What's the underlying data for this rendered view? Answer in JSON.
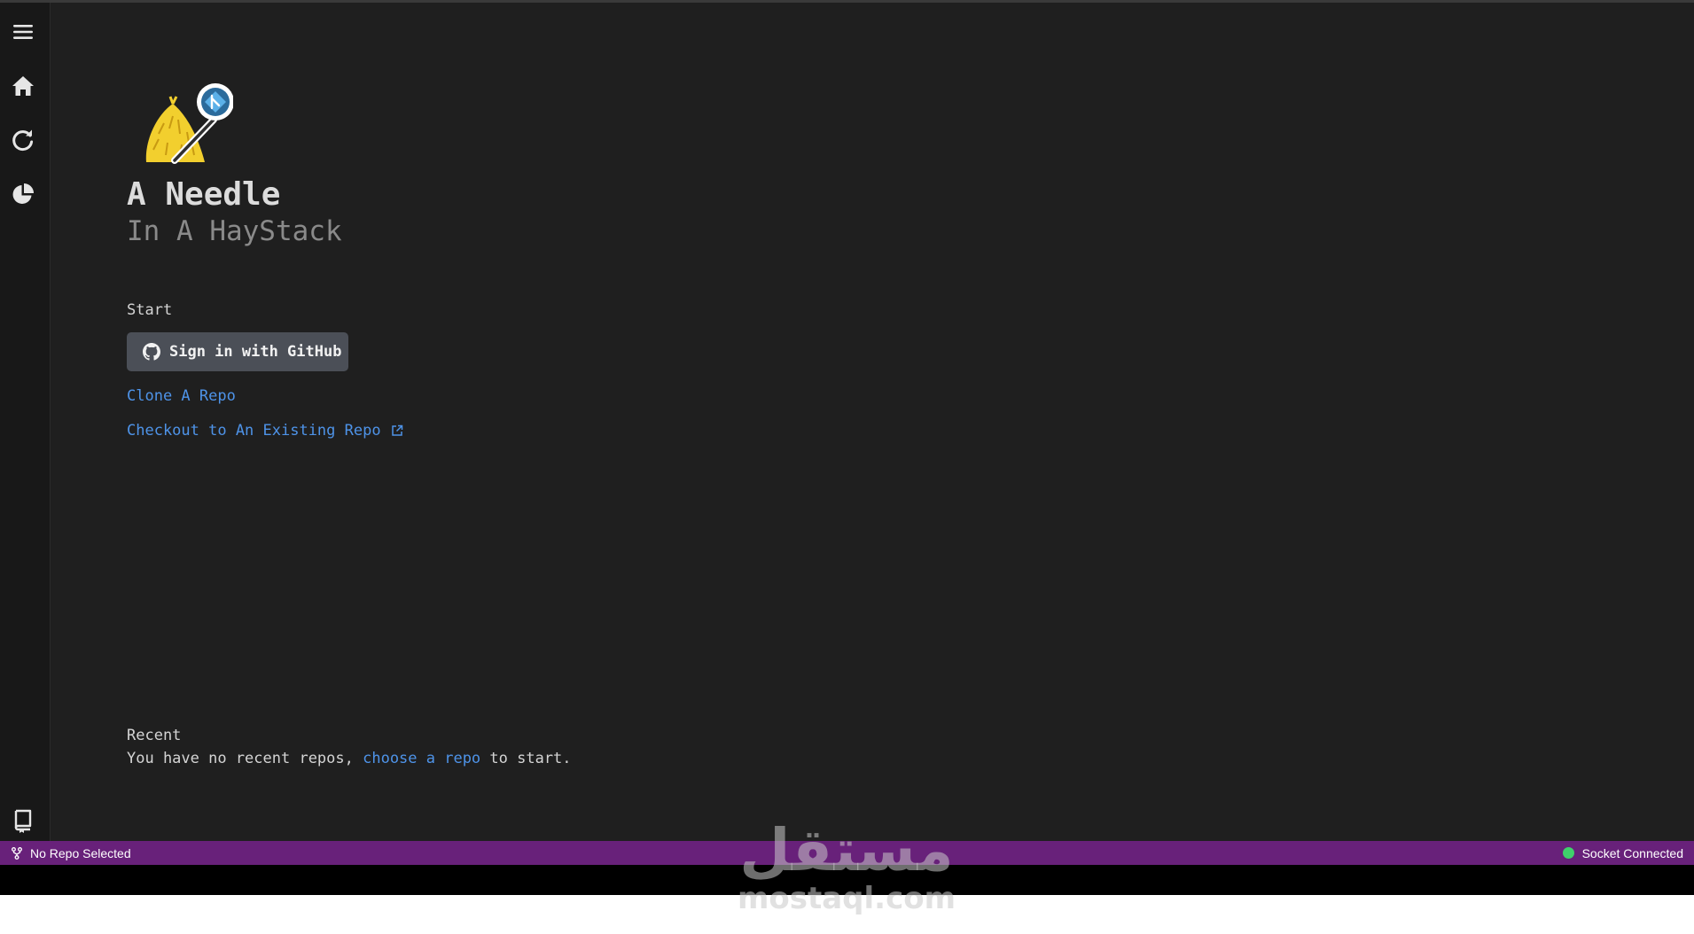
{
  "activity_bar": {
    "items": [
      {
        "name": "menu",
        "icon": "hamburger-menu-icon"
      },
      {
        "name": "home",
        "icon": "home-icon"
      },
      {
        "name": "refresh",
        "icon": "refresh-icon"
      },
      {
        "name": "stats",
        "icon": "pie-chart-icon"
      }
    ],
    "bottom_item": {
      "name": "repo",
      "icon": "repo-book-icon"
    }
  },
  "welcome": {
    "logo_icon": "haystack-needle-logo",
    "title": "A Needle",
    "subtitle": "In A HayStack",
    "start_heading": "Start",
    "github_button_label": "Sign in with GitHub",
    "clone_link": "Clone A Repo",
    "checkout_link": "Checkout to An Existing Repo",
    "recent_heading": "Recent",
    "recent_prefix": "You have no recent repos, ",
    "recent_link": "choose a repo",
    "recent_suffix": " to start."
  },
  "status_bar": {
    "left_label": "No Repo Selected",
    "right_label": "Socket Connected",
    "background_color": "#68217a",
    "connected_color": "#3fd16b"
  },
  "watermark": {
    "arabic": "مستقل",
    "latin": "mostaql.com"
  },
  "colors": {
    "background": "#1f1f1f",
    "link": "#4e93e8",
    "button": "#4b4f57"
  }
}
